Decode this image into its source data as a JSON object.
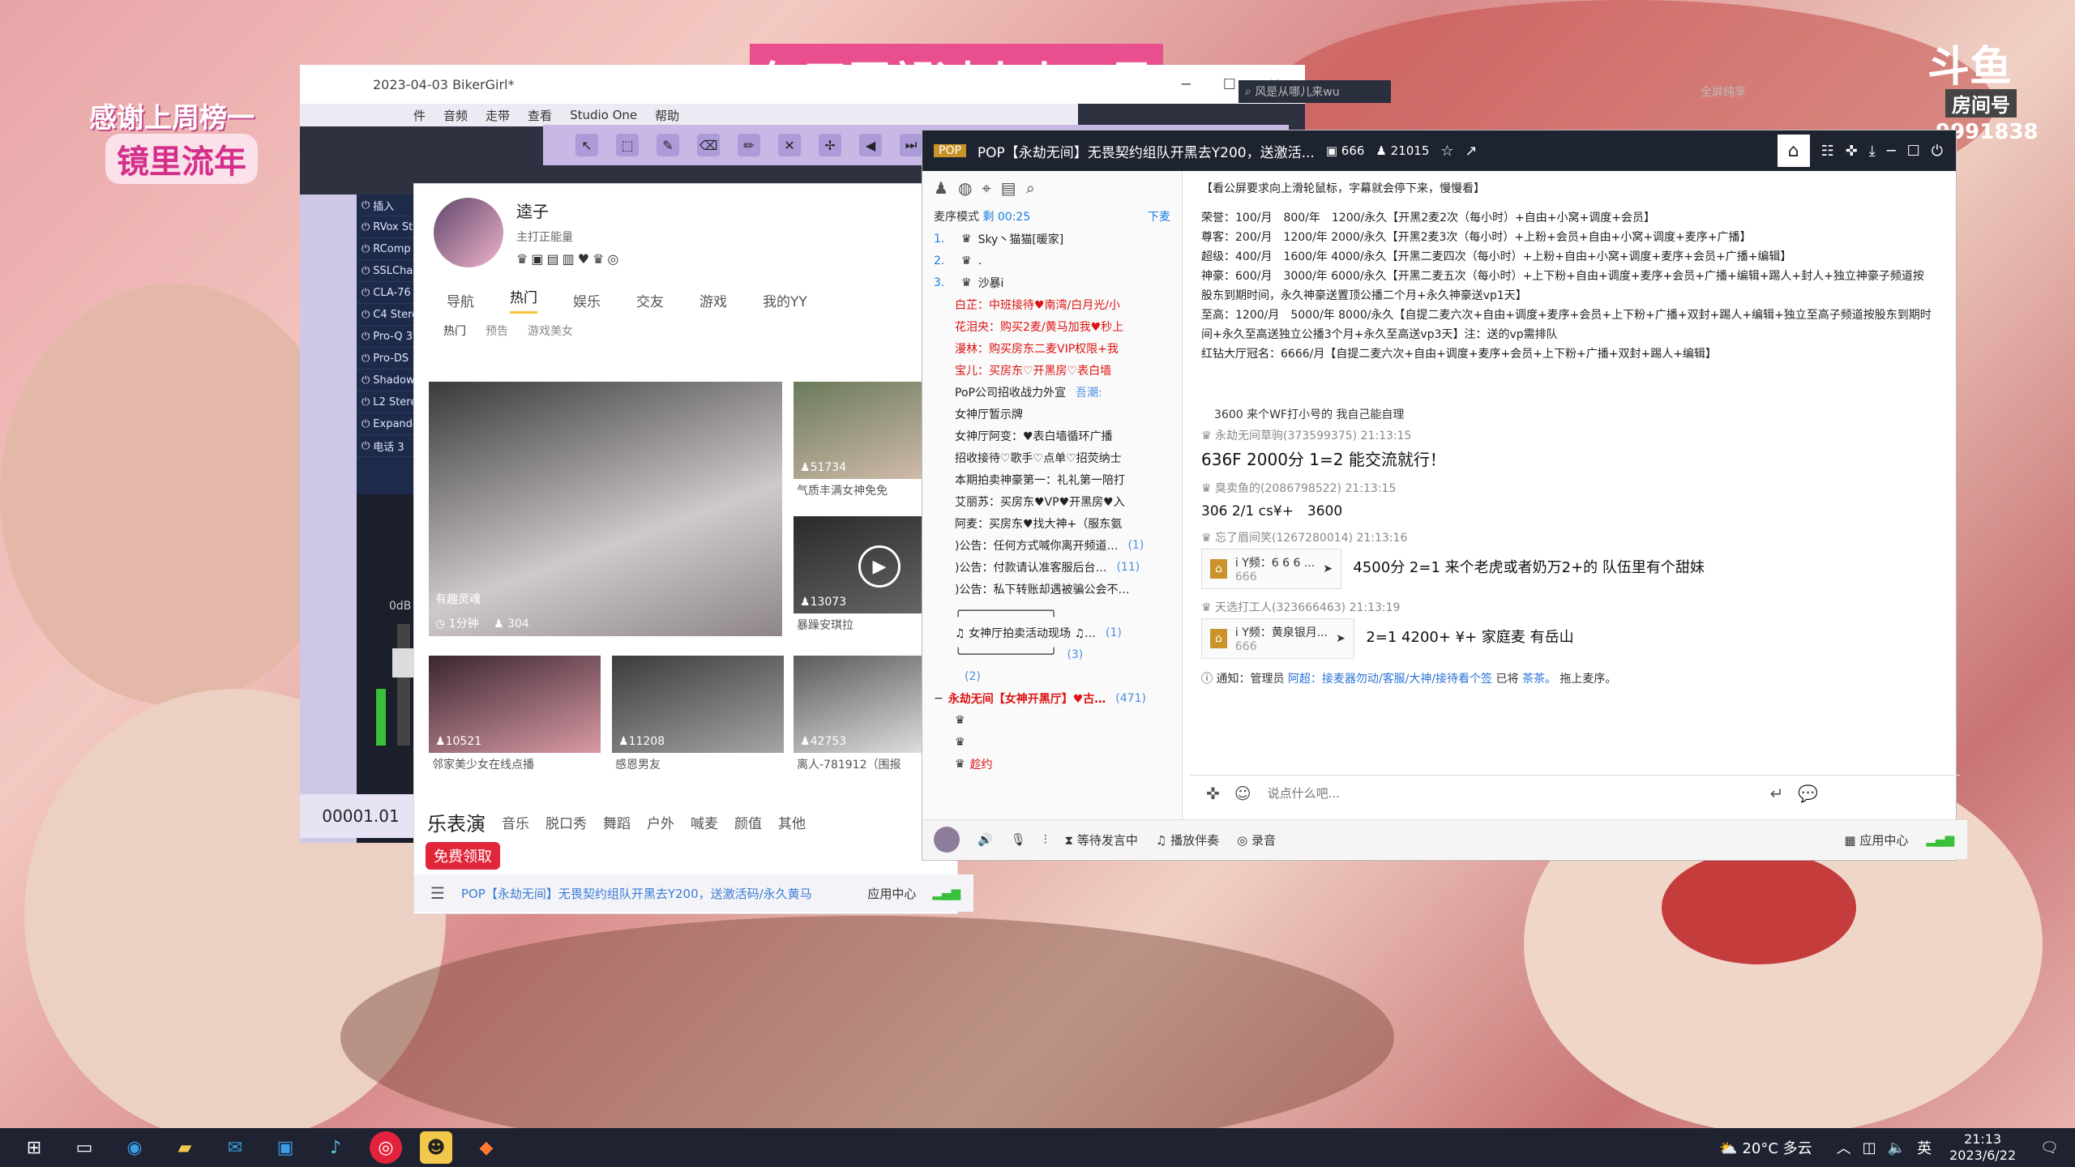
{
  "overlay": {
    "thanks": "感谢上周榜一",
    "name": "镜里流年",
    "banner": "每天愿望过小小三星",
    "douyu_logo": "斗鱼",
    "room_id_label": "房间号",
    "room_id": "9991838"
  },
  "daw": {
    "title": "2023-04-03 BikerGirl*",
    "menu": [
      "件",
      "音频",
      "走带",
      "查看",
      "Studio One",
      "帮助"
    ],
    "plugins": [
      "插入",
      "RVox St",
      "RComp",
      "SSLCha",
      "CLA-76",
      "C4 Stere",
      "Pro-Q 3",
      "Pro-DS",
      "Shadow",
      "L2 Stere",
      "Expande",
      "电话 3"
    ],
    "db": "0dB",
    "time": "00001.01"
  },
  "yy": {
    "user_name": "逵子",
    "user_sub": "主打正能量",
    "tabs": [
      "导航",
      "热门",
      "娱乐",
      "交友",
      "游戏",
      "我的YY"
    ],
    "subtabs": [
      "热门",
      "预告",
      "游戏美女"
    ],
    "big_tile": {
      "label": "有趣灵魂",
      "duration": "1分钟",
      "viewers": "304"
    },
    "tiles": [
      {
        "count": "51734",
        "title": "气质丰满女神免免"
      },
      {
        "count": "13073",
        "title": "暴躁安琪拉"
      },
      {
        "count": "10521",
        "title": "邻家美少女在线点播"
      },
      {
        "count": "11208",
        "title": "感恩男友"
      },
      {
        "count": "42753",
        "title": "离人-781912（围报"
      }
    ],
    "section_title": "乐表演",
    "cats": [
      "音乐",
      "脱口秀",
      "舞蹈",
      "户外",
      "喊麦",
      "颜值",
      "其他"
    ],
    "free": "免费领取",
    "bottom": "POP【永劫无间】无畏契约组队开黑去Y200，送激活码/永久黄马",
    "app_center": "应用中心"
  },
  "room": {
    "title": "POP【永劫无间】无畏契约组队开黑去Y200，送激活...",
    "room_num": "666",
    "viewers": "21015",
    "search": "风是从哪儿来wu",
    "fullscreen": "全屏纯享",
    "mode_label": "麦序模式",
    "mode_time": "剩 00:25",
    "mode_action": "下麦",
    "queue": [
      {
        "num": "1.",
        "name": "Sky丶猫猫[暖家]"
      },
      {
        "num": "2.",
        "name": "."
      },
      {
        "num": "3.",
        "name": "沙暴i"
      }
    ],
    "channels": [
      {
        "text": "白芷：中班接待♥南湾/白月光/小",
        "red": true,
        "count": ""
      },
      {
        "text": "花泪央：购买2麦/黄马加我♥秒上",
        "red": true,
        "count": ""
      },
      {
        "text": "漫林：购买房东二麦VIP权限+我",
        "red": true,
        "count": ""
      },
      {
        "text": "宝儿：买房东♡开黑房♡表白墙",
        "red": true,
        "count": ""
      },
      {
        "text": "PoP公司招收战力外宣",
        "red": false,
        "count": "吾潮:"
      },
      {
        "text": "女神厅暂示牌",
        "red": false,
        "count": ""
      },
      {
        "text": "女神厅阿变：♥表白墙循环广播",
        "red": false,
        "count": ""
      },
      {
        "text": "招收接待♡歌手♡点单♡招荧纳士",
        "red": false,
        "count": ""
      },
      {
        "text": "本期拍卖神豪第一：礼礼第一陪打",
        "red": false,
        "count": ""
      },
      {
        "text": "艾丽苏：买房东♥VP♥开黑房♥入",
        "red": false,
        "count": ""
      },
      {
        "text": "阿麦：买房东♥找大神+（服东氨",
        "red": false,
        "count": ""
      },
      {
        "text": ")公告：任何方式喊你离开频道…",
        "red": false,
        "count": "(1)"
      },
      {
        "text": ")公告：付款请认准客服后台…",
        "red": false,
        "count": "(11)"
      },
      {
        "text": ")公告：私下转账却遇被骗公会不…",
        "red": false,
        "count": ""
      },
      {
        "text": "╭─────────────╮",
        "red": false,
        "count": ""
      },
      {
        "text": "♫ 女神厅拍卖活动现场 ♫…",
        "red": false,
        "count": "(1)"
      },
      {
        "text": "╰─────────────╯",
        "red": false,
        "count": "(3)"
      },
      {
        "text": "",
        "red": false,
        "count": "(2)"
      }
    ],
    "hot_channel": "永劫无间【女神开黑厅】♥古…",
    "hot_count": "(471)",
    "hot_sub": [
      "",
      "",
      "趁约"
    ],
    "notice_head": "【看公屏要求向上滑轮鼠标，字幕就会停下来，慢慢看】",
    "notice_lines": [
      "荣誉：100/月　800/年　1200/永久【开黑2麦2次（每小时）+自由+小窝+调度+会员】",
      "尊客：200/月　1200/年 2000/永久【开黑2麦3次（每小时）+上粉+会员+自由+小窝+调度+麦序+广播】",
      "超级：400/月　1600/年 4000/永久【开黑二麦四次（每小时）+上粉+自由+小窝+调度+麦序+会员+广播+编辑】",
      "神豪：600/月　3000/年 6000/永久【开黑二麦五次（每小时）+上下粉+自由+调度+麦序+会员+广播+编辑+踢人+封人+独立神豪子频道按股东到期时间，永久神豪送置顶公播二个月+永久神豪送vp1天】",
      "至高：1200/月　5000/年 8000/永久【自提二麦六次+自由+调度+麦序+会员+上下粉+广播+双封+踢人+编辑+独立至高子频道按股东到期时间+永久至高送独立公播3个月+永久至高送vp3天】注：送的vp需排队",
      "红钻大厅冠名：6666/月【自提二麦六次+自由+调度+麦序+会员+上下粉+广播+双封+踢人+编辑】"
    ],
    "prev_line": "3600 来个WF打小号的 我自己能自理",
    "messages": [
      {
        "user": "永劫无间草驹(373599375)",
        "time": "21:13:15",
        "text": "636F 2000分 1=2 能交流就行！",
        "card": "",
        "card_sub": ""
      },
      {
        "user": "臭卖鱼的(2086798522)",
        "time": "21:13:15",
        "text": "306 2/1 cs¥+　3600",
        "card": "",
        "card_sub": ""
      },
      {
        "user": "忘了眉间笑(1267280014)",
        "time": "21:13:16",
        "text": "4500分 2=1 来个老虎或者奶万2+的 队伍里有个甜妹",
        "card": "i Y频：6 6 6 ...",
        "card_sub": "666"
      },
      {
        "user": "天选打工人(323666463)",
        "time": "21:13:19",
        "text": "2=1 4200+ ¥+ 家庭麦 有岳山",
        "card": "i Y频：黄泉银月...",
        "card_sub": "666"
      }
    ],
    "sys_notice_pre": "通知：管理员",
    "sys_notice_link1": "阿超：接麦器勿动/客服/大神/接待看个签",
    "sys_notice_mid": "已将",
    "sys_notice_link2": "茶茶。",
    "sys_notice_post": "拖上麦序。",
    "chat_placeholder": "说点什么吧...",
    "footer": {
      "wait": "等待发言中",
      "accompany": "播放伴奏",
      "record": "录音",
      "app_center": "应用中心"
    }
  },
  "taskbar": {
    "weather": "20°C 多云",
    "lang": "英",
    "time": "21:13",
    "date": "2023/6/22"
  }
}
